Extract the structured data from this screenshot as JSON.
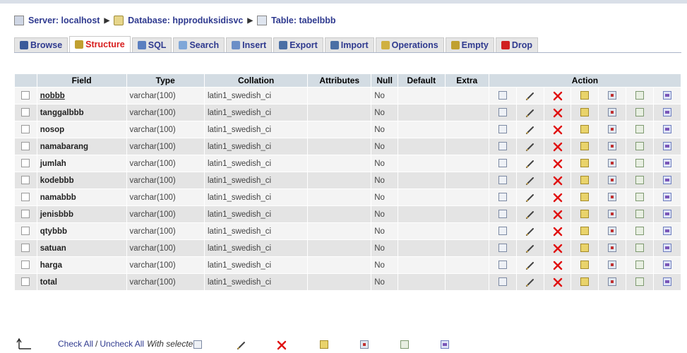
{
  "breadcrumb": {
    "server": "Server: localhost",
    "database": "Database: hpproduksidisvc",
    "table": "Table: tabelbbb"
  },
  "tabs": [
    {
      "label": "Browse",
      "icon": "browse-tab-icon",
      "color": "#3b5b9a"
    },
    {
      "label": "Structure",
      "icon": "structure-tab-icon",
      "color": "#c0a030"
    },
    {
      "label": "SQL",
      "icon": "sql-tab-icon",
      "color": "#5b7fc0"
    },
    {
      "label": "Search",
      "icon": "search-tab-icon",
      "color": "#7fa7d8"
    },
    {
      "label": "Insert",
      "icon": "insert-tab-icon",
      "color": "#6c8fc7"
    },
    {
      "label": "Export",
      "icon": "export-tab-icon",
      "color": "#4a6fa5"
    },
    {
      "label": "Import",
      "icon": "import-tab-icon",
      "color": "#4a6fa5"
    },
    {
      "label": "Operations",
      "icon": "operations-tab-icon",
      "color": "#d0b040"
    },
    {
      "label": "Empty",
      "icon": "empty-tab-icon",
      "color": "#c0a030"
    },
    {
      "label": "Drop",
      "icon": "drop-tab-icon",
      "color": "#d02020"
    }
  ],
  "active_tab": "Structure",
  "table": {
    "headers": {
      "field": "Field",
      "type": "Type",
      "collation": "Collation",
      "attributes": "Attributes",
      "null": "Null",
      "default": "Default",
      "extra": "Extra",
      "action": "Action"
    },
    "rows": [
      {
        "field": "nobbb",
        "type": "varchar(100)",
        "collation": "latin1_swedish_ci",
        "attributes": "",
        "null": "No",
        "default": "",
        "extra": "",
        "primary": true
      },
      {
        "field": "tanggalbbb",
        "type": "varchar(100)",
        "collation": "latin1_swedish_ci",
        "attributes": "",
        "null": "No",
        "default": "",
        "extra": ""
      },
      {
        "field": "nosop",
        "type": "varchar(100)",
        "collation": "latin1_swedish_ci",
        "attributes": "",
        "null": "No",
        "default": "",
        "extra": ""
      },
      {
        "field": "namabarang",
        "type": "varchar(100)",
        "collation": "latin1_swedish_ci",
        "attributes": "",
        "null": "No",
        "default": "",
        "extra": ""
      },
      {
        "field": "jumlah",
        "type": "varchar(100)",
        "collation": "latin1_swedish_ci",
        "attributes": "",
        "null": "No",
        "default": "",
        "extra": ""
      },
      {
        "field": "kodebbb",
        "type": "varchar(100)",
        "collation": "latin1_swedish_ci",
        "attributes": "",
        "null": "No",
        "default": "",
        "extra": ""
      },
      {
        "field": "namabbb",
        "type": "varchar(100)",
        "collation": "latin1_swedish_ci",
        "attributes": "",
        "null": "No",
        "default": "",
        "extra": ""
      },
      {
        "field": "jenisbbb",
        "type": "varchar(100)",
        "collation": "latin1_swedish_ci",
        "attributes": "",
        "null": "No",
        "default": "",
        "extra": ""
      },
      {
        "field": "qtybbb",
        "type": "varchar(100)",
        "collation": "latin1_swedish_ci",
        "attributes": "",
        "null": "No",
        "default": "",
        "extra": ""
      },
      {
        "field": "satuan",
        "type": "varchar(100)",
        "collation": "latin1_swedish_ci",
        "attributes": "",
        "null": "No",
        "default": "",
        "extra": ""
      },
      {
        "field": "harga",
        "type": "varchar(100)",
        "collation": "latin1_swedish_ci",
        "attributes": "",
        "null": "No",
        "default": "",
        "extra": ""
      },
      {
        "field": "total",
        "type": "varchar(100)",
        "collation": "latin1_swedish_ci",
        "attributes": "",
        "null": "No",
        "default": "",
        "extra": ""
      }
    ],
    "action_icons": [
      "browse-distinct-icon",
      "edit-icon",
      "drop-icon",
      "primary-key-icon",
      "unique-icon",
      "index-icon",
      "fulltext-icon"
    ]
  },
  "footer": {
    "check_all": "Check All",
    "separator": "/",
    "uncheck_all": "Uncheck All",
    "with_selected": "With selected:",
    "icons": [
      "browse-selected-icon",
      "edit-selected-icon",
      "drop-selected-icon",
      "primary-selected-icon",
      "unique-selected-icon",
      "index-selected-icon",
      "fulltext-selected-icon"
    ]
  },
  "colors": {
    "link": "#2f3a8f",
    "active_tab": "#d81e1e",
    "header_bg": "#d3dce3",
    "row_odd": "#f4f4f4",
    "row_even": "#e4e4e4"
  }
}
